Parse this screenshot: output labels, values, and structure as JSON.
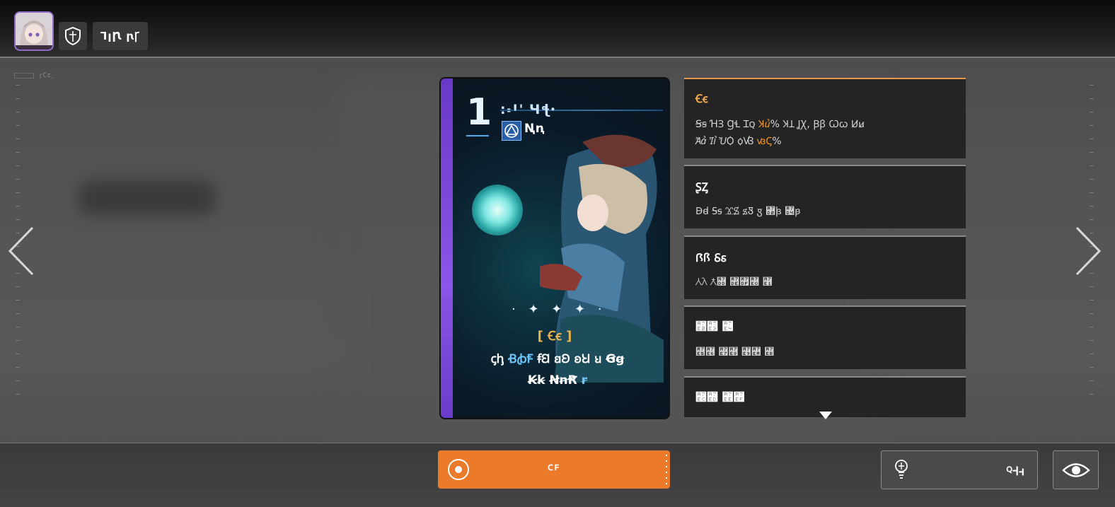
{
  "header": {
    "tag_button_label": "ꞀꞁꞂ ꞃꞄ",
    "left_label": "ꞅꞆꞇꞈ"
  },
  "card": {
    "cost": "1",
    "name": "꞉꞊Ꞌꞌ Ɥꞎꞏ",
    "type_label": "Ꞑꞑ",
    "keyword": "[ Ꞓꞓ ]",
    "desc_line1_a": "ꞔꞕ ",
    "desc_line1_hl": "ꞖꞗꞘ",
    "desc_line1_b": " ꞙꞚ ꞛꞜ ꞝꞞ ꞟ Ꞡꞡ",
    "desc_line2_a": "Ꞣꞣ ꞤꞥꞦ ",
    "desc_line2_hl": "ꞧ"
  },
  "details": [
    {
      "title": "Ꞓꞓ",
      "line1_a": "Ꞩꞩ ꞪꞫ ꞬꞭ Ɪꞯ ",
      "line1_hl": "Ʞꞿ",
      "line1_b": "% ꞰꞱ ꞲꞳ, Ꞵꞵ Ꞷꞷ Ꞹꞹ",
      "line2_a": "Ꞻꞻ Ꞽꞽ ꞾꟀ ꟁꟂ ",
      "line2_hl": "ꟃꟄ",
      "line2_b": "%"
    },
    {
      "title": "ꟅꟆ",
      "text": "Ꟈꟈ Ꟊꟊ ꟋꟌ ꟍꟐ ꟑ ꟒ꟓ ꟔ꟕ"
    },
    {
      "title": "Ꟗꟗ Ꟙꟙ",
      "text": "Ꟛꟛ Ƛ꟝ ꟞꟟꟠ ꟡"
    },
    {
      "title": "꟢꟣ ꟤",
      "text": "꟥꟦ ꟧꟨ ꟩꟪ ꟫"
    },
    {
      "title": "꟬꟭ ꟮꟯"
    }
  ],
  "bottom": {
    "primary_label": "ꟲꟳ",
    "hint_label": "ꟴꟵꟶ"
  },
  "colors": {
    "accent_orange": "#ec7a2b",
    "highlight_blue": "#6ec7ff",
    "highlight_orange": "#f39a2c",
    "card_stripe": "#7a45da"
  },
  "icons": {
    "shield": "shield-icon",
    "left_arrow": "chevron-left-icon",
    "right_arrow": "chevron-right-icon",
    "primary": "target-icon",
    "hint": "lightbulb-icon",
    "eye": "eye-icon"
  }
}
